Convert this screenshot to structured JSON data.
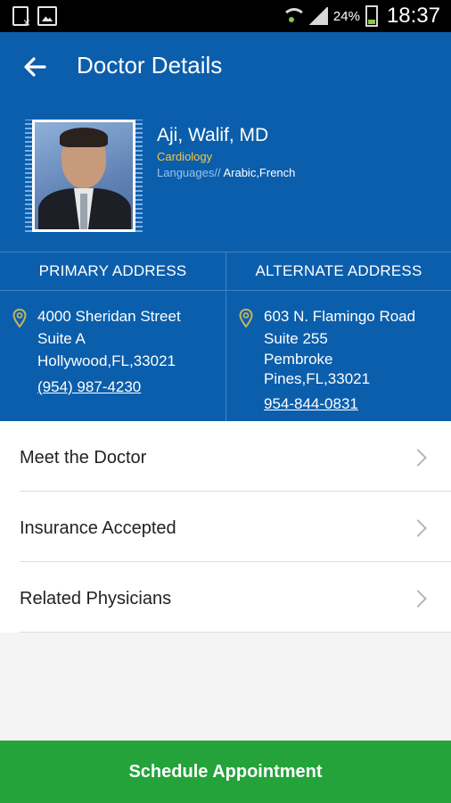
{
  "status_bar": {
    "battery": "24%",
    "time": "18:37",
    "icons": [
      "file-icon",
      "gallery-icon",
      "wifi-icon",
      "signal-icon",
      "battery-icon"
    ]
  },
  "app_bar": {
    "title": "Doctor Details",
    "back_icon": "arrow-left-icon"
  },
  "doctor": {
    "name": "Aji, Walif, MD",
    "specialty": "Cardiology",
    "languages_label": "Languages//",
    "languages_value": " Arabic,French"
  },
  "addresses": {
    "primary": {
      "header": "PRIMARY ADDRESS",
      "lines": [
        "4000 Sheridan Street",
        "Suite A",
        "Hollywood,FL,33021"
      ],
      "phone": "(954) 987-4230"
    },
    "alternate": {
      "header": "ALTERNATE ADDRESS",
      "lines": [
        "603 N. Flamingo Road",
        "Suite 255",
        "Pembroke",
        "Pines,FL,33021"
      ],
      "phone": "954-844-0831"
    }
  },
  "menu": {
    "items": [
      {
        "label": "Meet the Doctor"
      },
      {
        "label": "Insurance Accepted"
      },
      {
        "label": "Related Physicians"
      }
    ]
  },
  "cta": {
    "label": "Schedule Appointment"
  },
  "colors": {
    "header_blue": "#0b5eab",
    "specialty_gold": "#f4c84a",
    "cta_green": "#23a33a"
  }
}
